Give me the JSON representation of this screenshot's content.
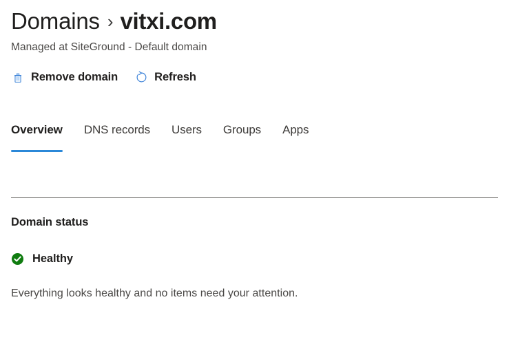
{
  "header": {
    "breadcrumb_root": "Domains",
    "breadcrumb_separator": "›",
    "breadcrumb_current": "vitxi.com",
    "subtitle": "Managed at SiteGround - Default domain"
  },
  "toolbar": {
    "remove_domain_label": "Remove domain",
    "refresh_label": "Refresh",
    "icon_color": "#3b82d8"
  },
  "tabs": [
    {
      "label": "Overview",
      "active": true
    },
    {
      "label": "DNS records",
      "active": false
    },
    {
      "label": "Users",
      "active": false
    },
    {
      "label": "Groups",
      "active": false
    },
    {
      "label": "Apps",
      "active": false
    }
  ],
  "status_section": {
    "heading": "Domain status",
    "status_label": "Healthy",
    "status_color": "#107c10",
    "description": "Everything looks healthy and no items need your attention."
  },
  "theme": {
    "accent": "#2b88d8",
    "text_primary": "#201f1e",
    "text_secondary": "#4a4846",
    "divider": "#6e6c6a"
  }
}
